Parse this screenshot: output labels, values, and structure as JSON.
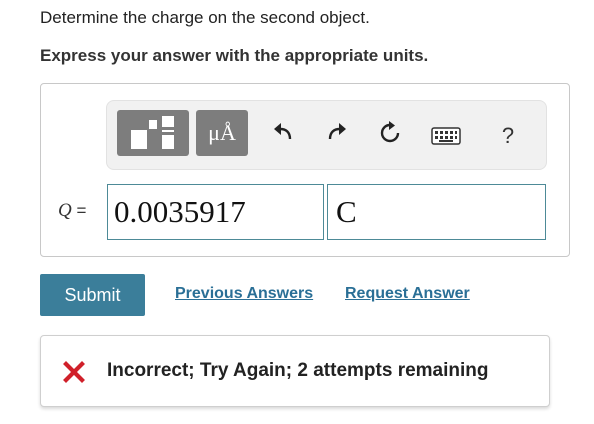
{
  "question": {
    "text": "Determine the charge on the second object.",
    "instruction": "Express your answer with the appropriate units."
  },
  "toolbar": {
    "template_tool": "template-icon",
    "units_label": "μÅ",
    "undo_icon": "undo-icon",
    "redo_icon": "redo-icon",
    "reset_icon": "reset-icon",
    "keyboard_icon": "keyboard-icon",
    "help_label": "?"
  },
  "answer": {
    "variable": "Q",
    "equals": "=",
    "value": "0.0035917",
    "unit": "C"
  },
  "actions": {
    "submit_label": "Submit",
    "previous_answers": "Previous Answers",
    "request_answer": "Request Answer"
  },
  "feedback": {
    "text": "Incorrect; Try Again; 2 attempts remaining",
    "status_icon": "x-icon"
  },
  "colors": {
    "submit_bg": "#3b7e9a",
    "link": "#2a6f96",
    "error_red": "#d0202a",
    "input_border": "#4d8a97",
    "tool_gray": "#7d7d7d"
  }
}
